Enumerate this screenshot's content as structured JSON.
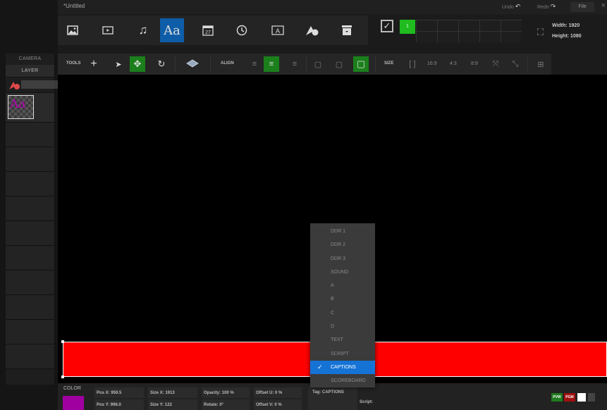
{
  "title": "*Untitled",
  "titlebar": {
    "undo": "Undo",
    "redo": "Redo",
    "file": "File",
    "close": "×"
  },
  "insert": {
    "aa": "Aa",
    "calendar_day": "27",
    "green_cell": "1"
  },
  "resolution": {
    "width": "Width: 1920",
    "height": "Height: 1080"
  },
  "side": {
    "camera": "CAMERA",
    "layer": "LAYER",
    "layer_thumb": "Aa"
  },
  "toolbar": {
    "tools": "TOOLS",
    "align": "ALIGN",
    "size": "SIZE",
    "r169": "16:9",
    "r43": "4:3",
    "r89": "8:9"
  },
  "props": {
    "color": "COLOR",
    "pos_x": "Pos X: 959.5",
    "pos_y": "Pos Y: 996.0",
    "size_x": "Size X: 1913",
    "size_y": "Size Y: 122",
    "opacity": "Opacity: 100 %",
    "rotate": "Rotate: 0°",
    "offset_u": "Offset U: 0 %",
    "offset_v": "Offset V: 0 %",
    "tag": "Tag: CAPTIONS",
    "script": "Script:",
    "pvw": "PVW",
    "pgm": "PGM"
  },
  "colors": {
    "accent": "#0e5da8",
    "selected": "#1673d6",
    "green": "#1b7f1b",
    "layer_color": "#a000a0",
    "caption_bar": "#ff0000"
  },
  "dropdown": {
    "items": [
      "DDR 1",
      "DDR 2",
      "DDR 3",
      "SOUND",
      "A",
      "B",
      "C",
      "D",
      "TEXT",
      "SCRIPT",
      "CAPTIONS",
      "SCOREBOARD"
    ],
    "selected": "CAPTIONS"
  }
}
